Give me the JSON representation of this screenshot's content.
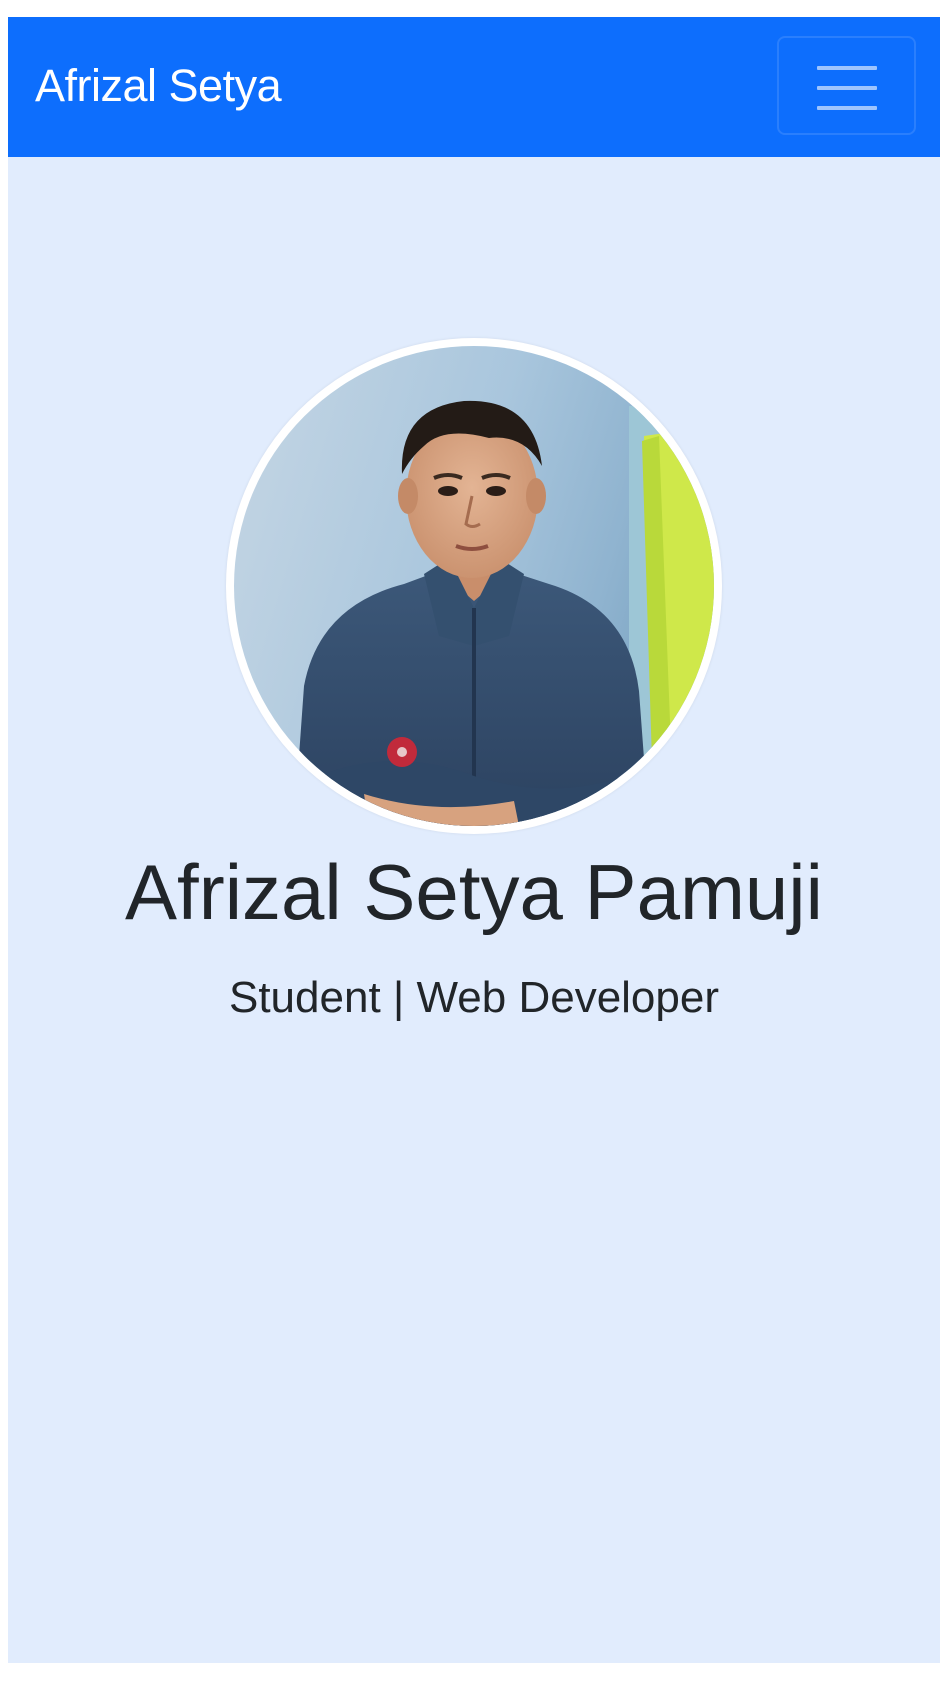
{
  "navbar": {
    "brand": "Afrizal Setya",
    "toggle_icon": "hamburger-menu-icon",
    "background_color": "#0d6efd",
    "text_color": "#ffffff"
  },
  "hero": {
    "background_color": "#e1ecfd",
    "profile_image": "profile-photo",
    "name": "Afrizal Setya Pamuji",
    "subtitle": "Student | Web Developer"
  }
}
